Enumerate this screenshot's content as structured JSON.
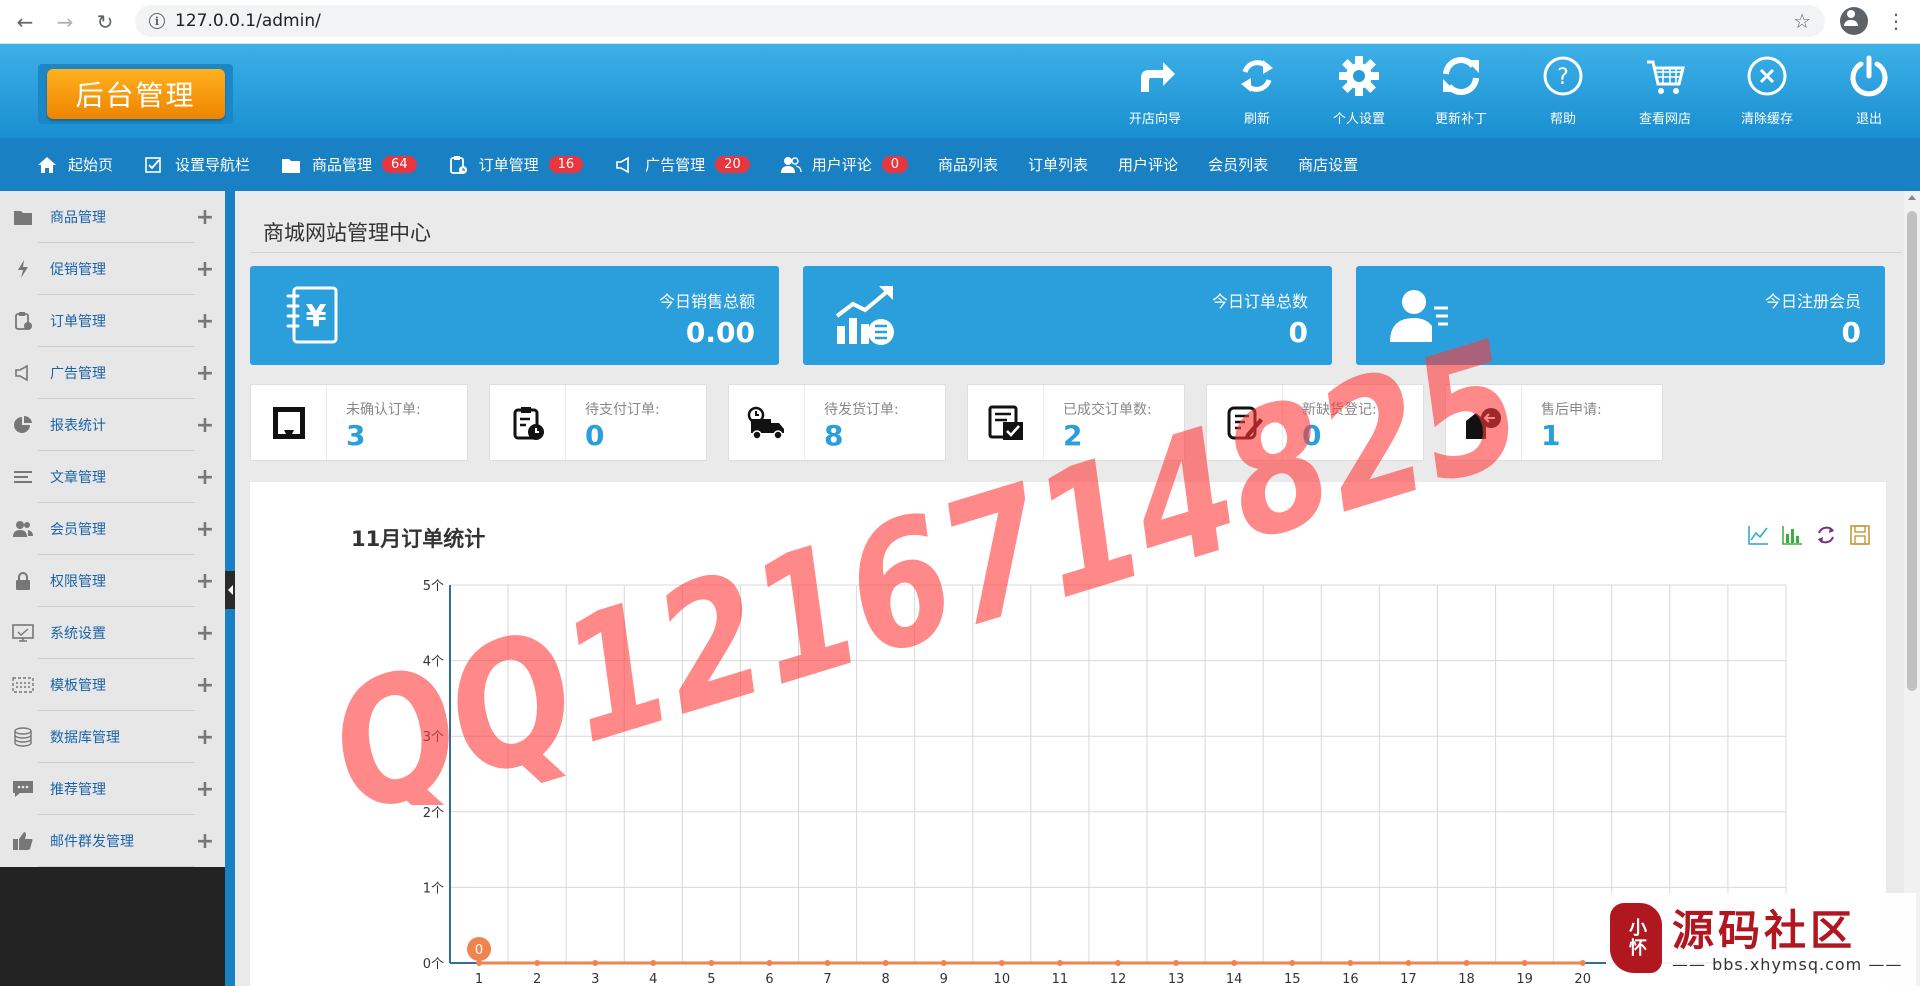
{
  "browser": {
    "url": "127.0.0.1/admin/"
  },
  "header": {
    "logo_text": "后台管理",
    "tools": [
      {
        "label": "开店向导",
        "icon": "share-arrow-icon"
      },
      {
        "label": "刷新",
        "icon": "refresh-icon"
      },
      {
        "label": "个人设置",
        "icon": "gear-icon"
      },
      {
        "label": "更新补丁",
        "icon": "sync-icon"
      },
      {
        "label": "帮助",
        "icon": "help-icon"
      },
      {
        "label": "查看网店",
        "icon": "cart-icon"
      },
      {
        "label": "清除缓存",
        "icon": "clear-icon"
      },
      {
        "label": "退出",
        "icon": "power-icon"
      }
    ]
  },
  "nav": {
    "items": [
      {
        "label": "起始页",
        "icon": "home-icon"
      },
      {
        "label": "设置导航栏",
        "icon": "checkbox-icon"
      },
      {
        "label": "商品管理",
        "icon": "folder-icon",
        "badge": "64"
      },
      {
        "label": "订单管理",
        "icon": "clipboard-icon",
        "badge": "16"
      },
      {
        "label": "广告管理",
        "icon": "megaphone-icon",
        "badge": "20"
      },
      {
        "label": "用户评论",
        "icon": "users-icon",
        "badge": "0"
      },
      {
        "label": "商品列表"
      },
      {
        "label": "订单列表"
      },
      {
        "label": "用户评论"
      },
      {
        "label": "会员列表"
      },
      {
        "label": "商店设置"
      }
    ]
  },
  "sidebar": {
    "items": [
      {
        "label": "商品管理",
        "icon": "folder-icon"
      },
      {
        "label": "促销管理",
        "icon": "lightning-icon"
      },
      {
        "label": "订单管理",
        "icon": "clipboard-icon"
      },
      {
        "label": "广告管理",
        "icon": "megaphone-icon"
      },
      {
        "label": "报表统计",
        "icon": "pie-chart-icon"
      },
      {
        "label": "文章管理",
        "icon": "list-icon"
      },
      {
        "label": "会员管理",
        "icon": "users-icon"
      },
      {
        "label": "权限管理",
        "icon": "lock-icon"
      },
      {
        "label": "系统设置",
        "icon": "monitor-icon"
      },
      {
        "label": "模板管理",
        "icon": "template-icon"
      },
      {
        "label": "数据库管理",
        "icon": "database-icon"
      },
      {
        "label": "推荐管理",
        "icon": "comment-icon"
      },
      {
        "label": "邮件群发管理",
        "icon": "thumbs-up-icon"
      }
    ],
    "expand_symbol": "+"
  },
  "main": {
    "title": "商城网站管理中心",
    "stats": [
      {
        "label": "今日销售总额",
        "value": "0.00",
        "icon": "yen-book-icon"
      },
      {
        "label": "今日订单总数",
        "value": "0",
        "icon": "growth-chart-icon"
      },
      {
        "label": "今日注册会员",
        "value": "0",
        "icon": "member-card-icon"
      }
    ],
    "cards": [
      {
        "label": "未确认订单:",
        "value": "3",
        "icon": "inbox-icon"
      },
      {
        "label": "待支付订单:",
        "value": "0",
        "icon": "payment-clipboard-icon"
      },
      {
        "label": "待发货订单:",
        "value": "8",
        "icon": "delivery-truck-icon"
      },
      {
        "label": "已成交订单数:",
        "value": "2",
        "icon": "completed-icon"
      },
      {
        "label": "新缺货登记:",
        "value": "0",
        "icon": "edit-note-icon"
      },
      {
        "label": "售后申请:",
        "value": "1",
        "icon": "return-icon"
      }
    ]
  },
  "chart_data": {
    "type": "line",
    "title": "11月订单统计",
    "x": [
      1,
      2,
      3,
      4,
      5,
      6,
      7,
      8,
      9,
      10,
      11,
      12,
      13,
      14,
      15,
      16,
      17,
      18,
      19,
      20
    ],
    "y_ticks": [
      "0个",
      "1个",
      "2个",
      "3个",
      "4个",
      "5个"
    ],
    "ylim": [
      0,
      5
    ],
    "series": [
      {
        "values": [
          0,
          0,
          0,
          0,
          0,
          0,
          0,
          0,
          0,
          0,
          0,
          0,
          0,
          0,
          0,
          0,
          0,
          0,
          0,
          0
        ],
        "color": "#f0834e"
      }
    ],
    "data_labels": [
      {
        "x": 1,
        "text": "0"
      }
    ],
    "grid": true,
    "legend": "none"
  },
  "watermark": {
    "text": "QQ1216714825"
  },
  "site_logo": {
    "main_text": "源码社区",
    "sub_text": "bbs.xhymsq.com",
    "badge_text": "小怀"
  },
  "colors": {
    "header": "#2ba4e0",
    "navbar": "#1880c3",
    "stat_card": "#2b9fdc",
    "badge": "#e8363e",
    "logo": "#f59a12",
    "chart_line": "#f0834e",
    "watermark": "#ff3a3a"
  }
}
